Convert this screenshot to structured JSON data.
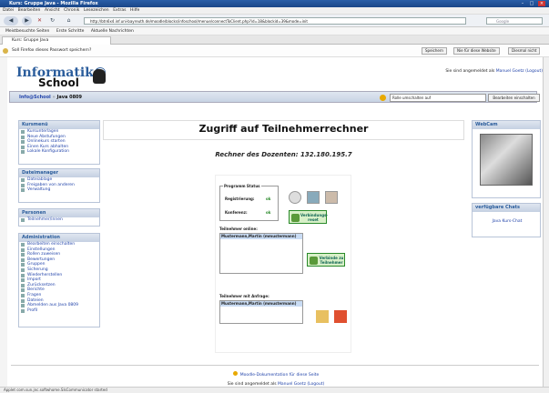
{
  "window": {
    "title": "Kurs: Gruppe Java - Mozilla Firefox"
  },
  "menu": [
    "Datei",
    "Bearbeiten",
    "Ansicht",
    "Chronik",
    "Lesezeichen",
    "Extras",
    "Hilfe"
  ],
  "nav": {
    "url": "http://btn6x4.inf.uni-bayreuth.de/moodle/blocks/infoschool/menue/connectToClient.php?id=18&blockid=39&mode=init",
    "search_placeholder": "Google"
  },
  "bookmarks": [
    "Meistbesuchte Seiten",
    "Erste Schritte",
    "Aktuelle Nachrichten"
  ],
  "tab": {
    "label": "Kurs: Gruppe Java"
  },
  "notification": {
    "text": "Soll Firefox dieses Passwort speichern?",
    "btn_save": "Speichern",
    "btn_never": "Nie für diese Website",
    "btn_not_now": "Diesmal nicht"
  },
  "header": {
    "logo_top": "Informatik@",
    "logo_bottom": "School",
    "logged_prefix": "Sie sind angemeldet als",
    "user": "Manuel Goetz",
    "logout": "(Logout)"
  },
  "crumbs": {
    "home": "Info@School",
    "sep": "»",
    "course": "Java 0809"
  },
  "role": {
    "selected": "Rolle umschalten auf",
    "button": "Bearbeiten einschalten"
  },
  "blocks": {
    "kursmenu": {
      "title": "Kursmenü",
      "items": [
        "Kursunterlagen",
        "Neue Abstufungen",
        "Onlinekurs starten",
        "Einen Kurs abhalten",
        "Lokale Konfiguration"
      ]
    },
    "dateimanager": {
      "title": "Dateimanager",
      "items": [
        "Dateiablage",
        "Freigaben von anderen",
        "Verwaltung"
      ]
    },
    "personen": {
      "title": "Personen",
      "items": [
        "Teilnehmer/innen"
      ]
    },
    "administration": {
      "title": "Administration",
      "items": [
        "Bearbeiten einschalten",
        "Einstellungen",
        "Rollen zuweisen",
        "Bewertungen",
        "Gruppen",
        "Sicherung",
        "Wiederherstellen",
        "Import",
        "Zurücksetzen",
        "Berichte",
        "Fragen",
        "Dateien",
        "Abmelden aus Java 0809",
        "Profil"
      ]
    }
  },
  "main": {
    "title": "Zugriff auf Teilnehmerrechner",
    "teacher": "Rechner des Dozenten: 132.180.195.7",
    "status": {
      "legend": "Programm Status",
      "row1_label": "Registrierung:",
      "row1_value": "ok",
      "row2_label": "Konferenz:",
      "row2_value": "ok"
    },
    "reset_btn": "Verbindungs-reset",
    "online_label": "Teilnehmer online:",
    "online_item": "Mustermann,Martin (mmustermann)",
    "connect_btn": "Verbinde zu Teilnehmer",
    "request_label": "Teilnehmer mit Anfrage:",
    "request_item": "Mustermann,Martin (mmustermann)"
  },
  "right": {
    "webcam_title": "WebCam",
    "chats_title": "verfügbare Chats",
    "chat_link": "Java Kurs-Chat"
  },
  "footer": {
    "doc": "Moodle-Dokumentation für diese Seite",
    "logged_prefix": "Sie sind angemeldet als",
    "user": "Manuel Goetz",
    "logout": "(Logout)"
  },
  "statusbar": "Applet com.sun.jnc.softwhome.SIsCommunicator started"
}
